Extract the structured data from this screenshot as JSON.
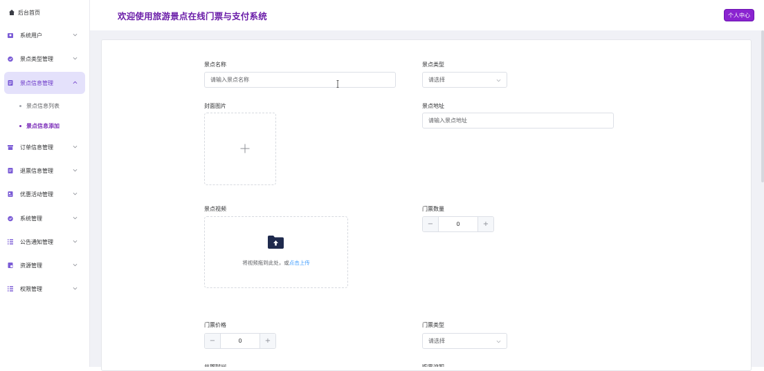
{
  "sidebar": {
    "home_label": "后台首页",
    "menu": [
      {
        "label": "系统用户",
        "icon": "user-icon"
      },
      {
        "label": "景点类型管理",
        "icon": "category-icon"
      },
      {
        "label": "景点信息管理",
        "icon": "document-icon",
        "expanded": true
      },
      {
        "label": "订单信息管理",
        "icon": "order-icon"
      },
      {
        "label": "退票信息管理",
        "icon": "refund-icon"
      },
      {
        "label": "优惠活动管理",
        "icon": "promotion-icon"
      },
      {
        "label": "系统管理",
        "icon": "system-icon"
      },
      {
        "label": "公告通知管理",
        "icon": "notice-icon"
      },
      {
        "label": "资源管理",
        "icon": "resource-icon"
      },
      {
        "label": "权限管理",
        "icon": "permission-icon"
      }
    ],
    "submenu": [
      {
        "label": "景点信息列表",
        "active": false
      },
      {
        "label": "景点信息添加",
        "active": true
      }
    ]
  },
  "header": {
    "title": "欢迎使用旅游景点在线门票与支付系统",
    "profile_button": "个人中心"
  },
  "form": {
    "name_label": "景点名称",
    "name_placeholder": "请输入景点名称",
    "type_label": "景点类型",
    "type_value": "请选择",
    "cover_label": "封面图片",
    "address_label": "景点地址",
    "address_placeholder": "请输入景点地址",
    "video_label": "景点视频",
    "video_drag_text": "将视频拖到此处，或",
    "video_click_upload": "点击上传",
    "ticket_count_label": "门票数量",
    "ticket_count_value": "0",
    "ticket_price_label": "门票价格",
    "ticket_price_value": "0",
    "ticket_type_label": "门票类型",
    "ticket_type_value": "请选择",
    "start_time_label": "开放时间",
    "purchase_notice_label": "购票须知",
    "minus": "−",
    "plus": "+"
  },
  "colors": {
    "accent": "#6a1ca8",
    "active_bg": "#e4e1fb",
    "profile_button_bg": "#8a23d0",
    "link": "#409eff"
  }
}
